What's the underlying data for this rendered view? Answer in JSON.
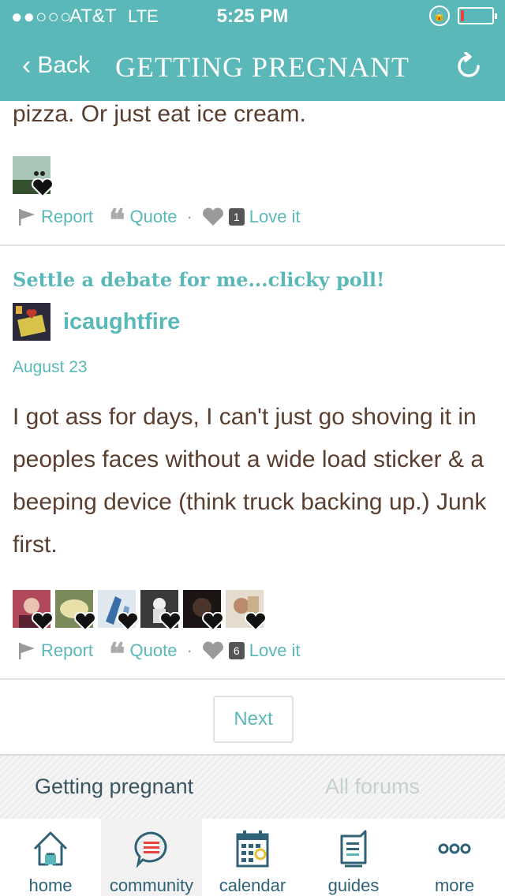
{
  "status_bar": {
    "signal": "●●○○○",
    "carrier": "AT&T",
    "network": "LTE",
    "time": "5:25 PM"
  },
  "nav": {
    "back_label": "Back",
    "title": "GETTING PREGNANT"
  },
  "previous_post": {
    "text_tail": "pizza. Or just eat ice cream.",
    "love_count": "1",
    "actions": {
      "report": "Report",
      "quote": "Quote",
      "separator": "·",
      "love": "Love it"
    }
  },
  "post": {
    "title": "Settle a debate for me...clicky poll!",
    "author": "icaughtfire",
    "date": "August 23",
    "body": "I got ass for days, I can't just go shoving it in peoples faces without a wide load sticker & a beeping device (think truck backing up.) Junk first.",
    "love_count": "6",
    "actions": {
      "report": "Report",
      "quote": "Quote",
      "separator": "·",
      "love": "Love it"
    }
  },
  "pagination": {
    "next_label": "Next"
  },
  "forum_bar": {
    "current": "Getting pregnant",
    "all": "All forums"
  },
  "tabs": [
    {
      "label": "home",
      "icon": "home-icon"
    },
    {
      "label": "community",
      "icon": "chat-bubble-icon",
      "active": true
    },
    {
      "label": "calendar",
      "icon": "calendar-icon"
    },
    {
      "label": "guides",
      "icon": "guide-document-icon"
    },
    {
      "label": "more",
      "icon": "more-dots-icon"
    }
  ],
  "colors": {
    "accent": "#5bb8b8",
    "text": "#5a3e30",
    "tab_icon": "#2f6177"
  }
}
